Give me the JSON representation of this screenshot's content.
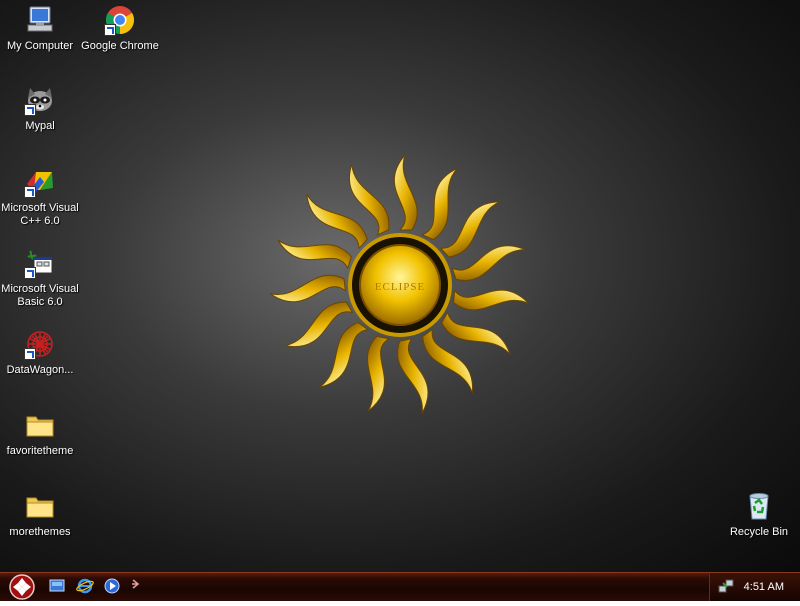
{
  "desktop": {
    "icons": [
      {
        "label": "My Computer",
        "icon": "my-computer-icon"
      },
      {
        "label": "Google Chrome",
        "icon": "chrome-icon"
      },
      {
        "label": "Mypal",
        "icon": "mypal-icon"
      },
      {
        "label": "Microsoft Visual C++ 6.0",
        "icon": "visual-cpp-icon"
      },
      {
        "label": "Microsoft Visual Basic 6.0",
        "icon": "visual-basic-icon"
      },
      {
        "label": "DataWagon...",
        "icon": "datawagon-icon"
      },
      {
        "label": "favoritetheme",
        "icon": "folder-icon"
      },
      {
        "label": "morethemes",
        "icon": "folder-icon"
      },
      {
        "label": "Recycle Bin",
        "icon": "recycle-bin-icon"
      }
    ],
    "wallpaper": {
      "logo_text": "ECLIPSE",
      "accent": "#e8b400"
    }
  },
  "taskbar": {
    "start_icon": "start-icon",
    "quick_launch": [
      {
        "icon": "show-desktop-icon"
      },
      {
        "icon": "internet-explorer-icon"
      },
      {
        "icon": "media-player-icon"
      },
      {
        "icon": "expand-arrow-icon"
      }
    ],
    "tray": {
      "network_icon": "network-icon",
      "clock": "4:51 AM"
    }
  }
}
